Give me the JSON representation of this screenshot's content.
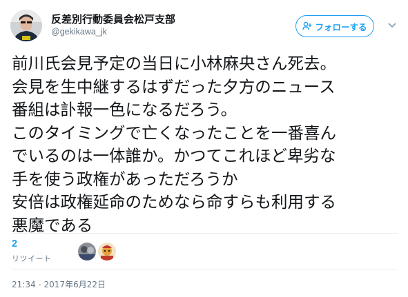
{
  "user": {
    "name": "反差別行動委員会松戸支部",
    "handle": "@gekikawa_jk"
  },
  "follow_button": {
    "label": "フォローする"
  },
  "tweet": {
    "lines": [
      "前川氏会見予定の当日に小林麻央さん死去。",
      "会見を生中継するはずだった夕方のニュース",
      "番組は訃報一色になるだろう。",
      "このタイミングで亡くなったことを一番喜ん",
      "でいるのは一体誰か。かつてこれほど卑劣な",
      "手を使う政権があっただろうか",
      "安倍は政権延命のためなら命すらも利用する",
      "悪魔である"
    ]
  },
  "stats": {
    "retweet_count": "2",
    "retweet_label": "リツイート"
  },
  "timestamp": "21:34 - 2017年6月22日",
  "colors": {
    "accent": "#1da1f2",
    "text": "#14171a",
    "muted": "#657786",
    "divider": "#e6ecf0"
  },
  "icons": {
    "follow": "add-user-icon",
    "caret": "chevron-down-icon"
  }
}
